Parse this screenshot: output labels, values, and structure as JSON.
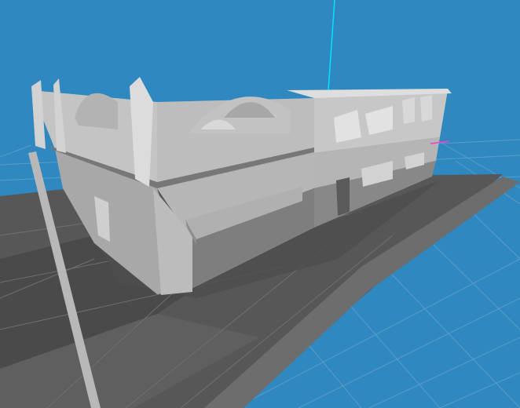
{
  "viewport": {
    "background_color": "#2f88c0",
    "grid_color": "#6aa6cf",
    "ground_color": "#575757",
    "sidewalk_color": "#6d6d6d",
    "building_light": "#c9c9c9",
    "building_mid": "#a9a9a9",
    "building_dark": "#8a8a8a",
    "axis_y_color": "#00e5ff",
    "axis_x_color": "#ff3bd5",
    "axis_z_color": "#9b9b9b"
  },
  "scene": {
    "model": "two-storey-storefront-building",
    "features": [
      "ornate-parapet",
      "street-awnings",
      "street-pole",
      "ground-plane-grid"
    ]
  }
}
